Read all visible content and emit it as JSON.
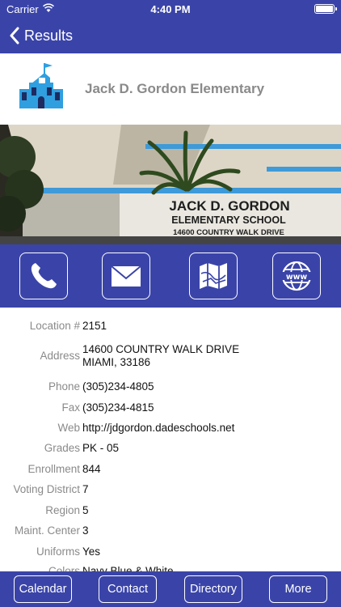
{
  "status_bar": {
    "carrier": "Carrier",
    "time": "4:40 PM"
  },
  "nav": {
    "back_label": "Results"
  },
  "school": {
    "name": "Jack D. Gordon Elementary",
    "sign_lines": [
      "JACK D. GORDON",
      "ELEMENTARY SCHOOL",
      "14600 COUNTRY WALK DRIVE"
    ]
  },
  "details": [
    {
      "label": "Location #",
      "value": "2151"
    },
    {
      "label": "Address",
      "value": "14600 COUNTRY WALK DRIVE",
      "value2": "MIAMI, 33186"
    },
    {
      "label": "Phone",
      "value": "(305)234-4805"
    },
    {
      "label": "Fax",
      "value": "(305)234-4815"
    },
    {
      "label": "Web",
      "value": "http://jdgordon.dadeschools.net"
    },
    {
      "label": "Grades",
      "value": "PK - 05"
    },
    {
      "label": "Enrollment",
      "value": "844"
    },
    {
      "label": "Voting District",
      "value": "7"
    },
    {
      "label": "Region",
      "value": "5"
    },
    {
      "label": "Maint. Center",
      "value": "3"
    },
    {
      "label": "Uniforms",
      "value": "Yes"
    },
    {
      "label": "Colors",
      "value": "Navy Blue & White"
    }
  ],
  "tabs": {
    "calendar": "Calendar",
    "contact": "Contact",
    "directory": "Directory",
    "more": "More"
  },
  "icons": {
    "back": "chevron-left-icon",
    "school": "school-building-icon",
    "phone": "phone-icon",
    "email": "envelope-icon",
    "map": "map-icon",
    "web": "globe-www-icon"
  },
  "colors": {
    "brand": "#3a44a8",
    "label_gray": "#8a8a8a",
    "icon_blue": "#2f9fe0"
  }
}
